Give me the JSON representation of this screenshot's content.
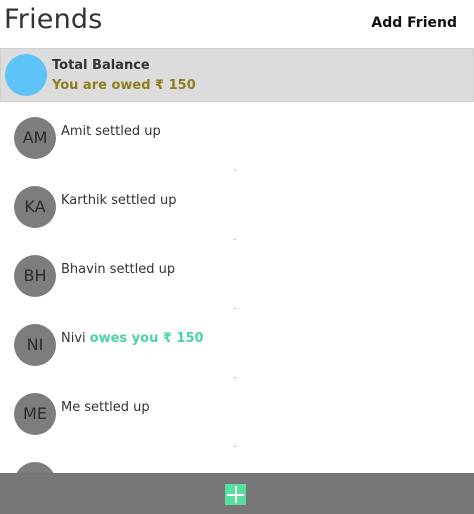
{
  "header": {
    "title": "Friends",
    "add_friend_label": "Add Friend"
  },
  "balance": {
    "title": "Total Balance",
    "summary": "You are owed ₹ 150",
    "status_color": "#8d7f1d",
    "avatar_color": "#5ec3f7"
  },
  "friends": [
    {
      "initials": "AM",
      "name": "Amit",
      "status": "settled up",
      "status_type": "settled"
    },
    {
      "initials": "KA",
      "name": "Karthik",
      "status": "settled up",
      "status_type": "settled"
    },
    {
      "initials": "BH",
      "name": "Bhavin",
      "status": "settled up",
      "status_type": "settled"
    },
    {
      "initials": "NI",
      "name": "Nivi",
      "status": "owes you ₹ 150",
      "status_type": "owes"
    },
    {
      "initials": "ME",
      "name": "Me",
      "status": "settled up",
      "status_type": "settled"
    }
  ],
  "colors": {
    "positive": "#4bd3a1",
    "bottom_bar": "#777777",
    "add_button": "#59df9d",
    "avatar": "#7d7d7d"
  },
  "icons": {
    "add": "plus-icon"
  }
}
